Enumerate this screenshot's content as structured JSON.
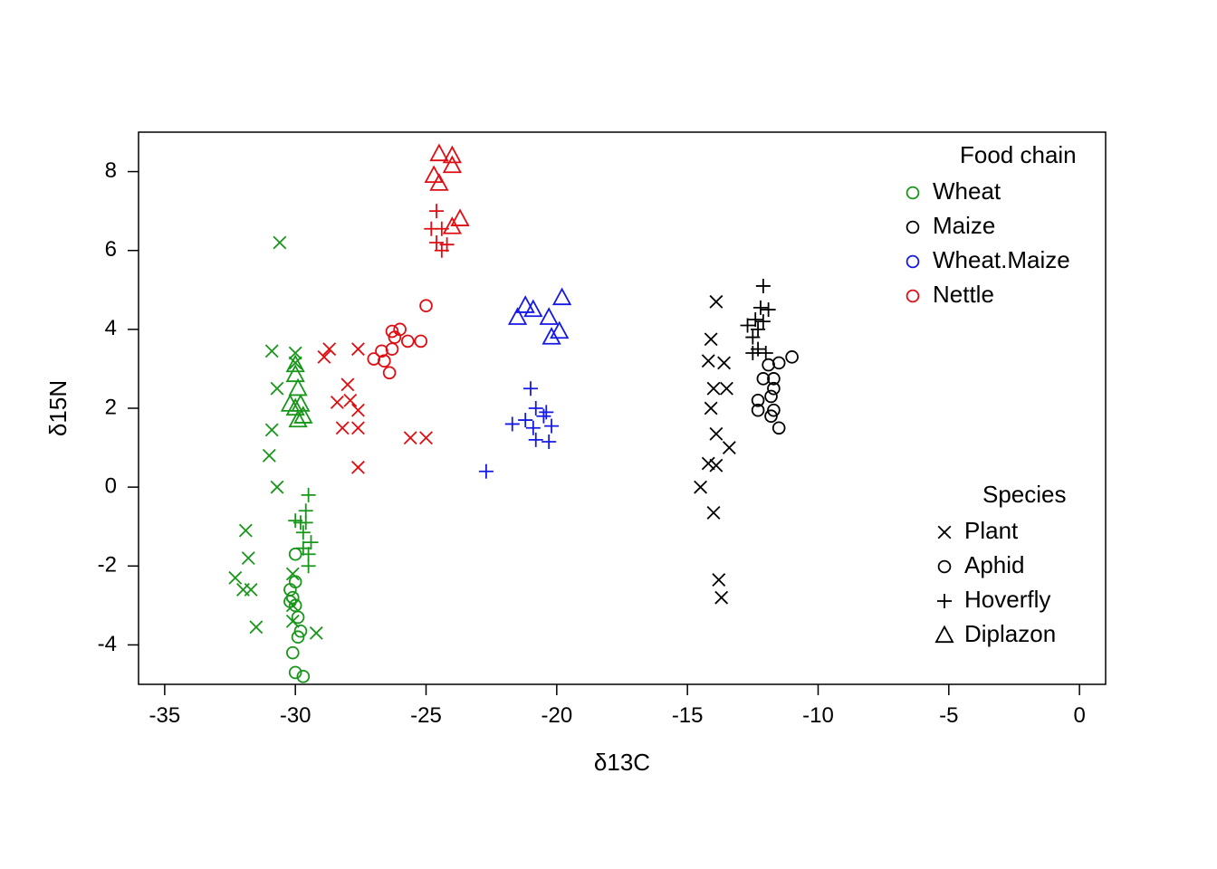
{
  "chart_data": {
    "type": "scatter",
    "xlabel": "δ13C",
    "ylabel": "δ15N",
    "xlim": [
      -36,
      1
    ],
    "ylim": [
      -5,
      9
    ],
    "x_ticks": [
      -35,
      -30,
      -25,
      -20,
      -15,
      -10,
      -5,
      0
    ],
    "y_ticks": [
      -4,
      -2,
      0,
      2,
      4,
      6,
      8
    ],
    "legends": {
      "color": {
        "title": "Food chain",
        "items": [
          {
            "label": "Wheat",
            "color": "#18961A"
          },
          {
            "label": "Maize",
            "color": "#000000"
          },
          {
            "label": "Wheat.Maize",
            "color": "#1418E6"
          },
          {
            "label": "Nettle",
            "color": "#DF0D12"
          }
        ]
      },
      "shape": {
        "title": "Species",
        "items": [
          {
            "label": "Plant",
            "shape": "x"
          },
          {
            "label": "Aphid",
            "shape": "o"
          },
          {
            "label": "Hoverfly",
            "shape": "+"
          },
          {
            "label": "Diplazon",
            "shape": "tri"
          }
        ]
      }
    },
    "series": [
      {
        "name": "Wheat",
        "color": "#18961A",
        "points": [
          {
            "x": -30.6,
            "y": 6.2,
            "shape": "x"
          },
          {
            "x": -30.9,
            "y": 3.45,
            "shape": "x"
          },
          {
            "x": -30.0,
            "y": 3.4,
            "shape": "x"
          },
          {
            "x": -30.0,
            "y": 3.15,
            "shape": "x"
          },
          {
            "x": -30.7,
            "y": 2.5,
            "shape": "x"
          },
          {
            "x": -30.9,
            "y": 1.45,
            "shape": "x"
          },
          {
            "x": -31.0,
            "y": 0.8,
            "shape": "x"
          },
          {
            "x": -30.7,
            "y": 0.0,
            "shape": "x"
          },
          {
            "x": -31.9,
            "y": -1.1,
            "shape": "x"
          },
          {
            "x": -31.8,
            "y": -1.8,
            "shape": "x"
          },
          {
            "x": -32.3,
            "y": -2.3,
            "shape": "x"
          },
          {
            "x": -32.0,
            "y": -2.6,
            "shape": "x"
          },
          {
            "x": -31.7,
            "y": -2.6,
            "shape": "x"
          },
          {
            "x": -30.1,
            "y": -2.2,
            "shape": "x"
          },
          {
            "x": -30.1,
            "y": -3.0,
            "shape": "x"
          },
          {
            "x": -30.1,
            "y": -3.4,
            "shape": "x"
          },
          {
            "x": -29.2,
            "y": -3.7,
            "shape": "x"
          },
          {
            "x": -31.5,
            "y": -3.55,
            "shape": "x"
          },
          {
            "x": -30.0,
            "y": -1.7,
            "shape": "o"
          },
          {
            "x": -30.0,
            "y": -2.4,
            "shape": "o"
          },
          {
            "x": -30.2,
            "y": -2.6,
            "shape": "o"
          },
          {
            "x": -30.1,
            "y": -2.8,
            "shape": "o"
          },
          {
            "x": -30.2,
            "y": -2.9,
            "shape": "o"
          },
          {
            "x": -30.0,
            "y": -3.0,
            "shape": "o"
          },
          {
            "x": -29.9,
            "y": -3.3,
            "shape": "o"
          },
          {
            "x": -29.8,
            "y": -3.65,
            "shape": "o"
          },
          {
            "x": -29.9,
            "y": -3.8,
            "shape": "o"
          },
          {
            "x": -30.1,
            "y": -4.2,
            "shape": "o"
          },
          {
            "x": -30.0,
            "y": -4.7,
            "shape": "o"
          },
          {
            "x": -29.7,
            "y": -4.8,
            "shape": "o"
          },
          {
            "x": -29.5,
            "y": -0.2,
            "shape": "+"
          },
          {
            "x": -29.6,
            "y": -0.6,
            "shape": "+"
          },
          {
            "x": -29.6,
            "y": -0.9,
            "shape": "+"
          },
          {
            "x": -29.8,
            "y": -0.9,
            "shape": "+"
          },
          {
            "x": -30.0,
            "y": -0.85,
            "shape": "+"
          },
          {
            "x": -29.7,
            "y": -1.15,
            "shape": "+"
          },
          {
            "x": -29.7,
            "y": -1.55,
            "shape": "+"
          },
          {
            "x": -29.4,
            "y": -1.4,
            "shape": "+"
          },
          {
            "x": -29.5,
            "y": -1.7,
            "shape": "+"
          },
          {
            "x": -29.5,
            "y": -2.0,
            "shape": "+"
          },
          {
            "x": -29.9,
            "y": 1.7,
            "shape": "tri"
          },
          {
            "x": -29.7,
            "y": 1.8,
            "shape": "tri"
          },
          {
            "x": -30.0,
            "y": 2.0,
            "shape": "tri"
          },
          {
            "x": -29.8,
            "y": 2.1,
            "shape": "tri"
          },
          {
            "x": -30.2,
            "y": 2.1,
            "shape": "tri"
          },
          {
            "x": -29.9,
            "y": 2.5,
            "shape": "tri"
          },
          {
            "x": -30.0,
            "y": 2.85,
            "shape": "tri"
          },
          {
            "x": -30.0,
            "y": 3.1,
            "shape": "tri"
          }
        ]
      },
      {
        "name": "Maize",
        "color": "#000000",
        "points": [
          {
            "x": -13.9,
            "y": 4.7,
            "shape": "x"
          },
          {
            "x": -14.1,
            "y": 3.75,
            "shape": "x"
          },
          {
            "x": -14.2,
            "y": 3.2,
            "shape": "x"
          },
          {
            "x": -13.6,
            "y": 3.15,
            "shape": "x"
          },
          {
            "x": -14.0,
            "y": 2.5,
            "shape": "x"
          },
          {
            "x": -13.5,
            "y": 2.5,
            "shape": "x"
          },
          {
            "x": -14.1,
            "y": 2.0,
            "shape": "x"
          },
          {
            "x": -13.9,
            "y": 1.35,
            "shape": "x"
          },
          {
            "x": -13.4,
            "y": 1.0,
            "shape": "x"
          },
          {
            "x": -14.2,
            "y": 0.6,
            "shape": "x"
          },
          {
            "x": -13.9,
            "y": 0.55,
            "shape": "x"
          },
          {
            "x": -14.5,
            "y": 0.0,
            "shape": "x"
          },
          {
            "x": -14.0,
            "y": -0.65,
            "shape": "x"
          },
          {
            "x": -13.8,
            "y": -2.35,
            "shape": "x"
          },
          {
            "x": -13.7,
            "y": -2.8,
            "shape": "x"
          },
          {
            "x": -11.0,
            "y": 3.3,
            "shape": "o"
          },
          {
            "x": -11.5,
            "y": 3.15,
            "shape": "o"
          },
          {
            "x": -11.9,
            "y": 3.1,
            "shape": "o"
          },
          {
            "x": -11.7,
            "y": 2.75,
            "shape": "o"
          },
          {
            "x": -12.1,
            "y": 2.75,
            "shape": "o"
          },
          {
            "x": -11.7,
            "y": 2.5,
            "shape": "o"
          },
          {
            "x": -11.8,
            "y": 2.3,
            "shape": "o"
          },
          {
            "x": -12.3,
            "y": 2.2,
            "shape": "o"
          },
          {
            "x": -12.3,
            "y": 1.95,
            "shape": "o"
          },
          {
            "x": -11.7,
            "y": 1.95,
            "shape": "o"
          },
          {
            "x": -11.8,
            "y": 1.8,
            "shape": "o"
          },
          {
            "x": -11.5,
            "y": 1.5,
            "shape": "o"
          },
          {
            "x": -12.1,
            "y": 5.1,
            "shape": "+"
          },
          {
            "x": -12.2,
            "y": 4.55,
            "shape": "+"
          },
          {
            "x": -11.9,
            "y": 4.5,
            "shape": "+"
          },
          {
            "x": -12.4,
            "y": 4.25,
            "shape": "+"
          },
          {
            "x": -12.1,
            "y": 4.2,
            "shape": "+"
          },
          {
            "x": -12.7,
            "y": 4.1,
            "shape": "+"
          },
          {
            "x": -12.3,
            "y": 4.0,
            "shape": "+"
          },
          {
            "x": -12.5,
            "y": 3.8,
            "shape": "+"
          },
          {
            "x": -12.3,
            "y": 3.5,
            "shape": "+"
          },
          {
            "x": -12.5,
            "y": 3.4,
            "shape": "+"
          },
          {
            "x": -12.0,
            "y": 3.4,
            "shape": "+"
          }
        ]
      },
      {
        "name": "Wheat.Maize",
        "color": "#1418E6",
        "points": [
          {
            "x": -21.0,
            "y": 2.5,
            "shape": "+"
          },
          {
            "x": -20.8,
            "y": 2.0,
            "shape": "+"
          },
          {
            "x": -20.5,
            "y": 1.8,
            "shape": "+"
          },
          {
            "x": -20.4,
            "y": 1.9,
            "shape": "+"
          },
          {
            "x": -21.2,
            "y": 1.7,
            "shape": "+"
          },
          {
            "x": -21.7,
            "y": 1.6,
            "shape": "+"
          },
          {
            "x": -20.9,
            "y": 1.5,
            "shape": "+"
          },
          {
            "x": -20.8,
            "y": 1.2,
            "shape": "+"
          },
          {
            "x": -20.2,
            "y": 1.55,
            "shape": "+"
          },
          {
            "x": -20.3,
            "y": 1.15,
            "shape": "+"
          },
          {
            "x": -22.7,
            "y": 0.4,
            "shape": "+"
          },
          {
            "x": -19.8,
            "y": 4.8,
            "shape": "tri"
          },
          {
            "x": -21.2,
            "y": 4.6,
            "shape": "tri"
          },
          {
            "x": -20.9,
            "y": 4.5,
            "shape": "tri"
          },
          {
            "x": -21.5,
            "y": 4.3,
            "shape": "tri"
          },
          {
            "x": -20.3,
            "y": 4.3,
            "shape": "tri"
          },
          {
            "x": -19.9,
            "y": 3.95,
            "shape": "tri"
          },
          {
            "x": -20.2,
            "y": 3.8,
            "shape": "tri"
          }
        ]
      },
      {
        "name": "Nettle",
        "color": "#DF0D12",
        "points": [
          {
            "x": -28.7,
            "y": 3.5,
            "shape": "x"
          },
          {
            "x": -28.9,
            "y": 3.3,
            "shape": "x"
          },
          {
            "x": -28.0,
            "y": 2.6,
            "shape": "x"
          },
          {
            "x": -27.6,
            "y": 1.95,
            "shape": "x"
          },
          {
            "x": -27.9,
            "y": 2.2,
            "shape": "x"
          },
          {
            "x": -28.4,
            "y": 2.15,
            "shape": "x"
          },
          {
            "x": -27.6,
            "y": 1.5,
            "shape": "x"
          },
          {
            "x": -28.2,
            "y": 1.5,
            "shape": "x"
          },
          {
            "x": -27.6,
            "y": 0.5,
            "shape": "x"
          },
          {
            "x": -27.6,
            "y": 3.5,
            "shape": "x"
          },
          {
            "x": -25.6,
            "y": 1.25,
            "shape": "x"
          },
          {
            "x": -25.0,
            "y": 1.25,
            "shape": "x"
          },
          {
            "x": -25.0,
            "y": 4.6,
            "shape": "o"
          },
          {
            "x": -26.0,
            "y": 4.0,
            "shape": "o"
          },
          {
            "x": -26.2,
            "y": 3.8,
            "shape": "o"
          },
          {
            "x": -26.3,
            "y": 3.95,
            "shape": "o"
          },
          {
            "x": -26.3,
            "y": 3.5,
            "shape": "o"
          },
          {
            "x": -25.7,
            "y": 3.7,
            "shape": "o"
          },
          {
            "x": -25.2,
            "y": 3.7,
            "shape": "o"
          },
          {
            "x": -26.7,
            "y": 3.45,
            "shape": "o"
          },
          {
            "x": -26.6,
            "y": 3.2,
            "shape": "o"
          },
          {
            "x": -27.0,
            "y": 3.25,
            "shape": "o"
          },
          {
            "x": -26.4,
            "y": 2.9,
            "shape": "o"
          },
          {
            "x": -24.6,
            "y": 7.0,
            "shape": "+"
          },
          {
            "x": -24.8,
            "y": 6.55,
            "shape": "+"
          },
          {
            "x": -24.4,
            "y": 6.55,
            "shape": "+"
          },
          {
            "x": -24.6,
            "y": 6.2,
            "shape": "+"
          },
          {
            "x": -24.4,
            "y": 6.0,
            "shape": "+"
          },
          {
            "x": -24.2,
            "y": 6.15,
            "shape": "+"
          },
          {
            "x": -24.5,
            "y": 8.45,
            "shape": "tri"
          },
          {
            "x": -24.0,
            "y": 8.4,
            "shape": "tri"
          },
          {
            "x": -24.0,
            "y": 8.15,
            "shape": "tri"
          },
          {
            "x": -24.7,
            "y": 7.9,
            "shape": "tri"
          },
          {
            "x": -24.5,
            "y": 7.7,
            "shape": "tri"
          },
          {
            "x": -23.7,
            "y": 6.8,
            "shape": "tri"
          },
          {
            "x": -24.0,
            "y": 6.6,
            "shape": "tri"
          }
        ]
      }
    ]
  }
}
